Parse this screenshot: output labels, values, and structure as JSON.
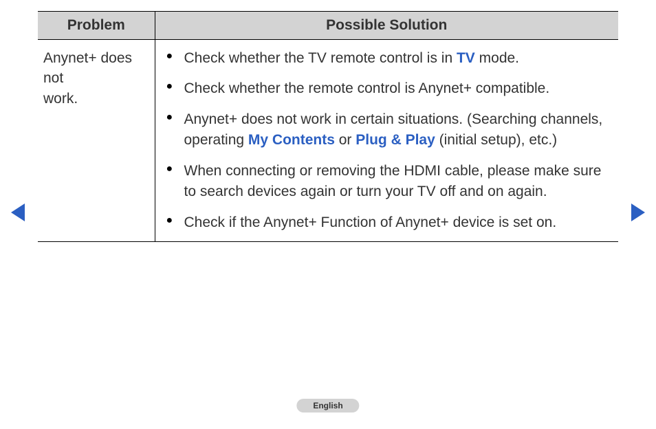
{
  "table": {
    "headers": {
      "problem": "Problem",
      "solution": "Possible Solution"
    },
    "row": {
      "problem_line1": "Anynet+ does not",
      "problem_line2": "work.",
      "solutions": {
        "item0_pre": "Check whether the TV remote control is in ",
        "item0_hl": "TV",
        "item0_post": " mode.",
        "item1": "Check whether the remote control is Anynet+ compatible.",
        "item2_pre": "Anynet+ does not work in certain situations. (Searching channels, operating ",
        "item2_hl1": "My Contents",
        "item2_mid": " or ",
        "item2_hl2": "Plug & Play",
        "item2_post": " (initial setup), etc.)",
        "item3": "When connecting or removing the HDMI cable, please make sure to search devices again or turn your TV off and on again.",
        "item4": "Check if the Anynet+ Function of Anynet+ device is set on."
      }
    }
  },
  "footer": {
    "language": "English"
  }
}
